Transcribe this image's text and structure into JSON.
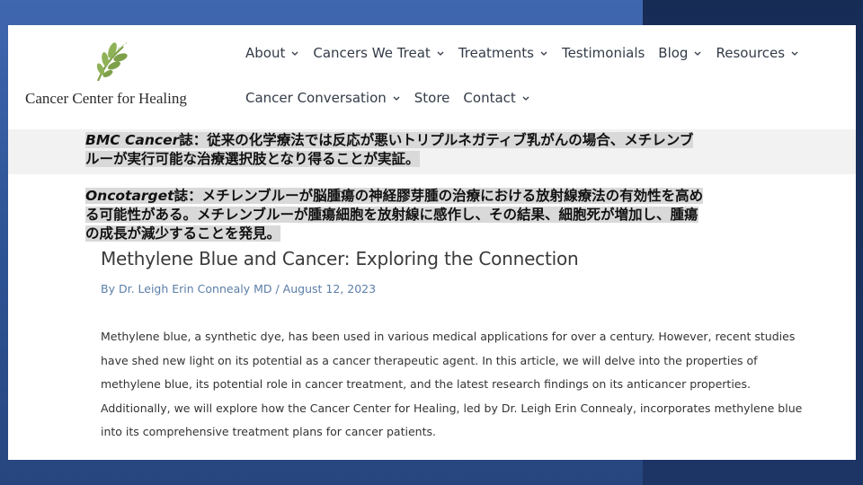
{
  "site": {
    "logo_text": "Cancer Center for Healing"
  },
  "nav": {
    "row1": [
      {
        "label": "About",
        "dropdown": true
      },
      {
        "label": "Cancers We Treat",
        "dropdown": true
      },
      {
        "label": "Treatments",
        "dropdown": true
      },
      {
        "label": "Testimonials",
        "dropdown": false
      },
      {
        "label": "Blog",
        "dropdown": true
      },
      {
        "label": "Resources",
        "dropdown": true
      }
    ],
    "row2": [
      {
        "label": "Cancer Conversation",
        "dropdown": true
      },
      {
        "label": "Store",
        "dropdown": false
      },
      {
        "label": "Contact",
        "dropdown": true
      }
    ]
  },
  "highlights": {
    "h1": {
      "journal": "BMC Cancer",
      "line1": "誌：従来の化学療法では反応が悪いトリプルネガティブ乳がんの場合、メチレンブ",
      "line2": "ルーが実行可能な治療選択肢となり得ることが実証。"
    },
    "h2": {
      "journal": "Oncotarget",
      "line1": "誌：メチレンブルーが脳腫瘍の神経膠芽腫の治療における放射線療法の有効性を高め",
      "line2": "る可能性がある。メチレンブルーが腫瘍細胞を放射線に感作し、その結果、細胞死が増加し、腫瘍",
      "line3": "の成長が減少することを発見。"
    }
  },
  "article": {
    "title": "Methylene Blue and Cancer: Exploring the Connection",
    "byline_prefix": "By ",
    "author": "Dr. Leigh Erin Connealy MD",
    "separator": " / ",
    "date": "August 12, 2023",
    "body": "Methylene blue, a synthetic dye, has been used in various medical applications for over a century. However, recent studies have shed new light on its potential as a cancer therapeutic agent. In this article, we will delve into the properties of methylene blue, its potential role in cancer treatment, and the latest research findings on its anticancer properties. Additionally, we will explore how the Cancer Center for Healing, led by Dr. Leigh Erin Connealy, incorporates methylene blue into its comprehensive treatment plans for cancer patients."
  },
  "colors": {
    "logo_green": "#7fa04a",
    "nav_text": "#333b47",
    "byline": "#5b7ea8",
    "highlight": "#d9d9d9"
  }
}
